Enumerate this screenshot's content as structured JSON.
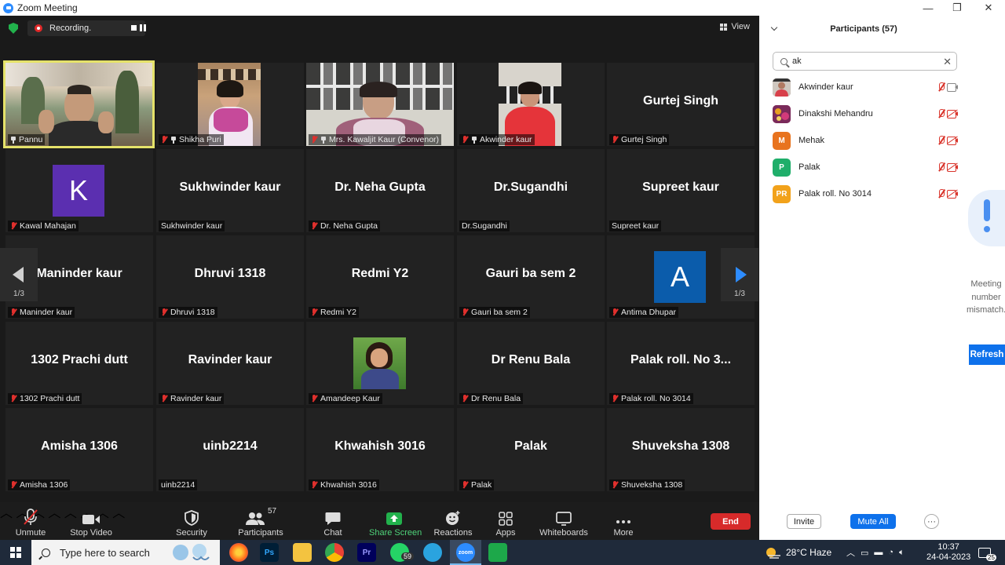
{
  "window": {
    "title": "Zoom Meeting",
    "minimize": "—",
    "maximize": "❐",
    "close": "✕"
  },
  "meeting_top": {
    "recording_label": "Recording.",
    "view_label": "View"
  },
  "tiles": [
    {
      "name": "Pannu",
      "display": "",
      "video": true,
      "muted": false,
      "pinned": true
    },
    {
      "name": "Shikha Puri",
      "display": "",
      "video": true,
      "muted": true,
      "pinned": true
    },
    {
      "name": "Mrs. Kawaljit Kaur (Convenor)",
      "display": "",
      "video": true,
      "muted": true,
      "pinned": true
    },
    {
      "name": "Akwinder kaur",
      "display": "",
      "video": true,
      "muted": true,
      "pinned": true
    },
    {
      "name": "Gurtej Singh",
      "display": "Gurtej Singh",
      "video": false,
      "muted": true,
      "pinned": false
    },
    {
      "name": "Kawal Mahajan",
      "display": "",
      "avatar_letter": "K",
      "avatar_color": "#5b2fb0",
      "muted": true
    },
    {
      "name": "Sukhwinder kaur",
      "display": "Sukhwinder kaur",
      "muted": false
    },
    {
      "name": "Dr. Neha Gupta",
      "display": "Dr. Neha Gupta",
      "muted": true
    },
    {
      "name": "Dr.Sugandhi",
      "display": "Dr.Sugandhi",
      "muted": false
    },
    {
      "name": "Supreet kaur",
      "display": "Supreet kaur",
      "muted": false
    },
    {
      "name": "Maninder kaur",
      "display": "Maninder kaur",
      "muted": true
    },
    {
      "name": "Dhruvi 1318",
      "display": "Dhruvi 1318",
      "muted": true
    },
    {
      "name": "Redmi Y2",
      "display": "Redmi Y2",
      "muted": true
    },
    {
      "name": "Gauri ba sem 2",
      "display": "Gauri ba sem 2",
      "muted": true
    },
    {
      "name": "Antima Dhupar",
      "display": "",
      "avatar_letter": "A",
      "avatar_color": "#0b5cab",
      "muted": true
    },
    {
      "name": "1302 Prachi dutt",
      "display": "1302 Prachi dutt",
      "muted": true
    },
    {
      "name": "Ravinder kaur",
      "display": "Ravinder kaur",
      "muted": true
    },
    {
      "name": "Amandeep Kaur",
      "display": "",
      "video": true,
      "muted": true
    },
    {
      "name": "Dr Renu Bala",
      "display": "Dr Renu Bala",
      "muted": true
    },
    {
      "name": "Palak roll. No 3014",
      "display": "Palak roll. No 3...",
      "muted": true
    },
    {
      "name": "Amisha 1306",
      "display": "Amisha 1306",
      "muted": true
    },
    {
      "name": "uinb2214",
      "display": "uinb2214",
      "muted": false
    },
    {
      "name": "Khwahish 3016",
      "display": "Khwahish 3016",
      "muted": true
    },
    {
      "name": "Palak",
      "display": "Palak",
      "muted": true
    },
    {
      "name": "Shuveksha 1308",
      "display": "Shuveksha 1308",
      "muted": true
    }
  ],
  "pager": {
    "left": "1/3",
    "right": "1/3"
  },
  "toolbar": {
    "unmute": "Unmute",
    "stop_video": "Stop Video",
    "security": "Security",
    "participants": "Participants",
    "participants_count": "57",
    "chat": "Chat",
    "share_screen": "Share Screen",
    "reactions": "Reactions",
    "apps": "Apps",
    "whiteboards": "Whiteboards",
    "more": "More",
    "end": "End"
  },
  "panel": {
    "title": "Participants (57)",
    "search_value": "ak",
    "participants": [
      {
        "name": "Akwinder kaur",
        "initials": "",
        "color": "#8a6a5a",
        "video_on": true
      },
      {
        "name": "Dinakshi Mehandru",
        "initials": "",
        "color": "#b0386a",
        "video_on": false
      },
      {
        "name": "Mehak",
        "initials": "M",
        "color": "#e8731e",
        "video_on": false
      },
      {
        "name": "Palak",
        "initials": "P",
        "color": "#1fae6a",
        "video_on": false
      },
      {
        "name": "Palak roll. No 3014",
        "initials": "PR",
        "color": "#f2a21b",
        "video_on": false
      }
    ],
    "mismatch_text": "Meeting number mismatch.",
    "refresh": "Refresh",
    "invite": "Invite",
    "mute_all": "Mute All",
    "more": "···"
  },
  "taskbar": {
    "search_placeholder": "Type here to search",
    "whatsapp_badge": "59",
    "weather": "28°C  Haze",
    "time": "10:37",
    "date": "24-04-2023",
    "notif_count": "25"
  }
}
